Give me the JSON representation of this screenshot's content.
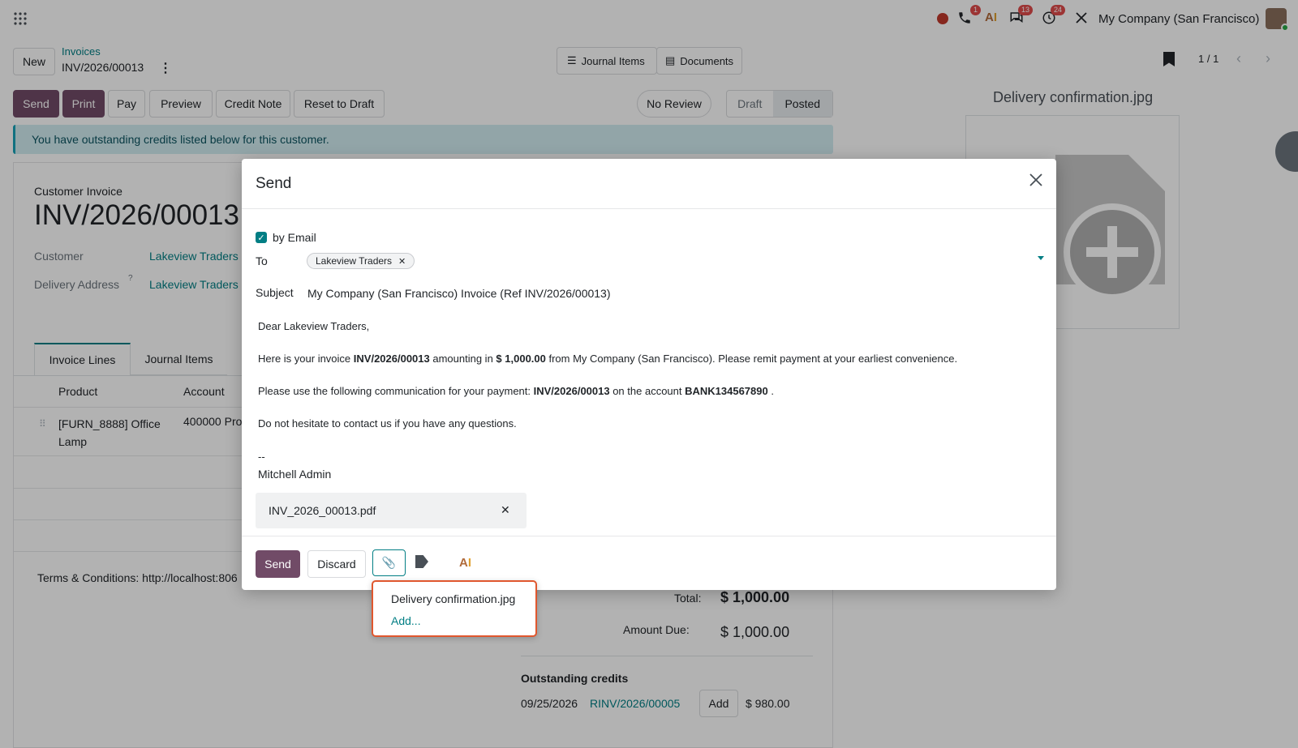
{
  "topbar": {
    "company": "My Company (San Francisco)",
    "badges": {
      "phone": "1",
      "chat": "13",
      "activity": "24"
    }
  },
  "control": {
    "new_label": "New",
    "breadcrumb_parent": "Invoices",
    "record_name": "INV/2026/00013",
    "journal_items_label": "Journal Items",
    "documents_label": "Documents",
    "pager": "1 / 1"
  },
  "actions": {
    "send": "Send",
    "print": "Print",
    "pay": "Pay",
    "preview": "Preview",
    "credit_note": "Credit Note",
    "reset": "Reset to Draft",
    "no_review": "No Review",
    "status_draft": "Draft",
    "status_posted": "Posted"
  },
  "alert": "You have outstanding credits listed below for this customer.",
  "invoice": {
    "type_label": "Customer Invoice",
    "number": "INV/2026/00013",
    "customer_label": "Customer",
    "customer_value": "Lakeview Traders",
    "delivery_label": "Delivery Address",
    "delivery_help": "?",
    "delivery_value": "Lakeview Traders",
    "tabs": [
      "Invoice Lines",
      "Journal Items"
    ],
    "col_product": "Product",
    "col_account": "Account",
    "line_product": "[FURN_8888] Office Lamp",
    "line_account": "400000 Pro",
    "terms": "Terms & Conditions: http://localhost:806",
    "total_label": "Total:",
    "total_value": "$ 1,000.00",
    "due_label": "Amount Due:",
    "due_value": "$ 1,000.00",
    "outstanding_title": "Outstanding credits",
    "credit_date": "09/25/2026",
    "credit_ref": "RINV/2026/00005",
    "credit_add": "Add",
    "credit_amount": "$ 980.00"
  },
  "side_panel": {
    "filename": "Delivery confirmation.jpg"
  },
  "modal": {
    "title": "Send",
    "by_email": "by Email",
    "to_label": "To",
    "to_tag": "Lakeview Traders",
    "subject_label": "Subject",
    "subject_value": "My Company (San Francisco) Invoice (Ref INV/2026/00013)",
    "greeting": "Dear Lakeview Traders,",
    "p1_a": "Here is your invoice ",
    "p1_b": "INV/2026/00013",
    "p1_c": " amounting in ",
    "p1_d": "$ 1,000.00",
    "p1_e": " from My Company (San Francisco). Please remit payment at your earliest convenience.",
    "p2_a": "Please use the following communication for your payment: ",
    "p2_b": "INV/2026/00013",
    "p2_c": " on the account ",
    "p2_d": "BANK134567890",
    "p2_e": " .",
    "p3": "Do not hesitate to contact us if you have any questions.",
    "sig_dash": "--",
    "sig_name": "Mitchell Admin",
    "attachment": "INV_2026_00013.pdf",
    "send_btn": "Send",
    "discard_btn": "Discard"
  },
  "dropdown": {
    "item1": "Delivery confirmation.jpg",
    "item2": "Add..."
  },
  "colors": {
    "primary": "#714b67",
    "link": "#017e84",
    "highlight": "#e0572e"
  }
}
